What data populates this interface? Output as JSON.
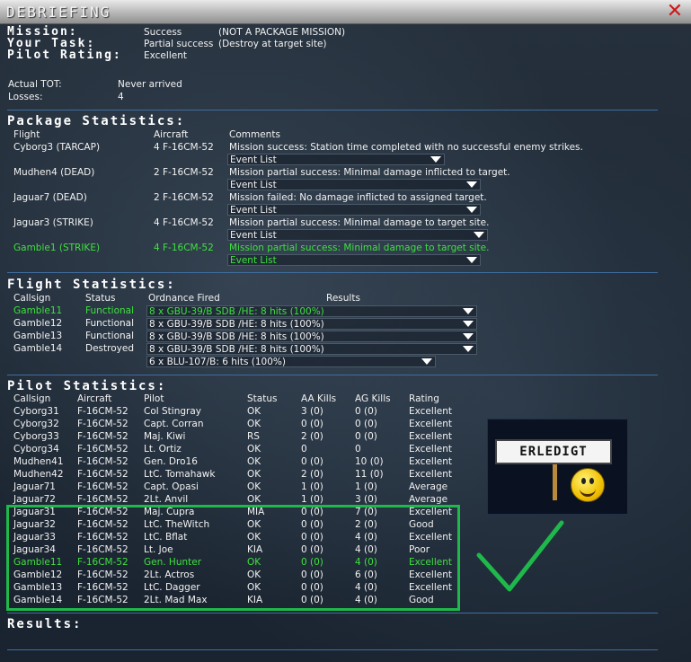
{
  "window": {
    "title": "DEBRIEFING"
  },
  "mission": {
    "labels": [
      "Mission:",
      "Your Task:",
      "Pilot Rating:"
    ],
    "values": [
      "Success",
      "Partial success",
      "Excellent"
    ],
    "notes": [
      "(NOT A PACKAGE MISSION)",
      "(Destroy  at target site)",
      ""
    ],
    "tot_label": "Actual TOT:",
    "tot_value": "Never arrived",
    "losses_label": "Losses:",
    "losses_value": "4"
  },
  "package": {
    "title": "Package Statistics:",
    "headers": [
      "Flight",
      "Aircraft",
      "Comments"
    ],
    "event_list_label": "Event List",
    "rows": [
      {
        "flight": "Cyborg3 (TARCAP)",
        "aircraft": "4 F-16CM-52",
        "comment": "Mission success: Station time completed with no successful enemy strikes.",
        "highlight": false
      },
      {
        "flight": "Mudhen4 (DEAD)",
        "aircraft": "2 F-16CM-52",
        "comment": "Mission partial success: Minimal damage inflicted to target.",
        "highlight": false
      },
      {
        "flight": "Jaguar7 (DEAD)",
        "aircraft": "2 F-16CM-52",
        "comment": "Mission failed: No damage inflicted to assigned target.",
        "highlight": false
      },
      {
        "flight": "Jaguar3 (STRIKE)",
        "aircraft": "4 F-16CM-52",
        "comment": "Mission partial success: Minimal damage to target site.",
        "highlight": false
      },
      {
        "flight": "Gamble1 (STRIKE)",
        "aircraft": "4 F-16CM-52",
        "comment": "Mission partial success: Minimal damage to target site.",
        "highlight": true
      }
    ]
  },
  "flight": {
    "title": "Flight Statistics:",
    "headers": [
      "Callsign",
      "Status",
      "Ordnance Fired",
      "Results"
    ],
    "rows": [
      {
        "callsign": "Gamble11",
        "status": "Functional",
        "ordnance": "8 x GBU-39/B SDB /HE: 8 hits (100%)",
        "highlight": true
      },
      {
        "callsign": "Gamble12",
        "status": "Functional",
        "ordnance": "8 x GBU-39/B SDB /HE: 8 hits (100%)",
        "highlight": false
      },
      {
        "callsign": "Gamble13",
        "status": "Functional",
        "ordnance": "8 x GBU-39/B SDB /HE: 8 hits (100%)",
        "highlight": false
      },
      {
        "callsign": "Gamble14",
        "status": "Destroyed",
        "ordnance": "8 x GBU-39/B SDB /HE: 8 hits (100%)",
        "highlight": false
      }
    ],
    "extra_ordnance": "6 x BLU-107/B: 6 hits (100%)"
  },
  "pilot": {
    "title": "Pilot Statistics:",
    "headers": [
      "Callsign",
      "Aircraft",
      "Pilot",
      "Status",
      "AA Kills",
      "AG Kills",
      "Rating"
    ],
    "rows": [
      {
        "callsign": "Cyborg31",
        "aircraft": "F-16CM-52",
        "pilot": "Col Stingray",
        "status": "OK",
        "aa": "3 (0)",
        "ag": "0 (0)",
        "rating": "Excellent",
        "highlight": false
      },
      {
        "callsign": "Cyborg32",
        "aircraft": "F-16CM-52",
        "pilot": "Capt. Corran",
        "status": "OK",
        "aa": "0 (0)",
        "ag": "0 (0)",
        "rating": "Excellent",
        "highlight": false
      },
      {
        "callsign": "Cyborg33",
        "aircraft": "F-16CM-52",
        "pilot": "Maj. Kiwi",
        "status": "RS",
        "aa": "2 (0)",
        "ag": "0 (0)",
        "rating": "Excellent",
        "highlight": false
      },
      {
        "callsign": "Cyborg34",
        "aircraft": "F-16CM-52",
        "pilot": "Lt. Ortiz",
        "status": "OK",
        "aa": "0",
        "ag": "0",
        "rating": "Excellent",
        "highlight": false
      },
      {
        "callsign": "Mudhen41",
        "aircraft": "F-16CM-52",
        "pilot": "Gen. Dro16",
        "status": "OK",
        "aa": "0 (0)",
        "ag": "10 (0)",
        "rating": "Excellent",
        "highlight": false
      },
      {
        "callsign": "Mudhen42",
        "aircraft": "F-16CM-52",
        "pilot": "LtC. Tomahawk",
        "status": "OK",
        "aa": "2 (0)",
        "ag": "11 (0)",
        "rating": "Excellent",
        "highlight": false
      },
      {
        "callsign": "Jaguar71",
        "aircraft": "F-16CM-52",
        "pilot": "Capt. Opasi",
        "status": "OK",
        "aa": "1 (0)",
        "ag": "1 (0)",
        "rating": "Average",
        "highlight": false
      },
      {
        "callsign": "Jaguar72",
        "aircraft": "F-16CM-52",
        "pilot": "2Lt. Anvil",
        "status": "OK",
        "aa": "1 (0)",
        "ag": "3 (0)",
        "rating": "Average",
        "highlight": false
      },
      {
        "callsign": "Jaguar31",
        "aircraft": "F-16CM-52",
        "pilot": "Maj. Cupra",
        "status": "MIA",
        "aa": "0 (0)",
        "ag": "7 (0)",
        "rating": "Excellent",
        "highlight": false
      },
      {
        "callsign": "Jaguar32",
        "aircraft": "F-16CM-52",
        "pilot": "LtC. TheWitch",
        "status": "OK",
        "aa": "0 (0)",
        "ag": "2 (0)",
        "rating": "Good",
        "highlight": false
      },
      {
        "callsign": "Jaguar33",
        "aircraft": "F-16CM-52",
        "pilot": "LtC. Bflat",
        "status": "OK",
        "aa": "0 (0)",
        "ag": "4 (0)",
        "rating": "Excellent",
        "highlight": false
      },
      {
        "callsign": "Jaguar34",
        "aircraft": "F-16CM-52",
        "pilot": "Lt. Joe",
        "status": "KIA",
        "aa": "0 (0)",
        "ag": "4 (0)",
        "rating": "Poor",
        "highlight": false
      },
      {
        "callsign": "Gamble11",
        "aircraft": "F-16CM-52",
        "pilot": "Gen. Hunter",
        "status": "OK",
        "aa": "0 (0)",
        "ag": "4 (0)",
        "rating": "Excellent",
        "highlight": true
      },
      {
        "callsign": "Gamble12",
        "aircraft": "F-16CM-52",
        "pilot": "2Lt. Actros",
        "status": "OK",
        "aa": "0 (0)",
        "ag": "6 (0)",
        "rating": "Excellent",
        "highlight": false
      },
      {
        "callsign": "Gamble13",
        "aircraft": "F-16CM-52",
        "pilot": "LtC. Dagger",
        "status": "OK",
        "aa": "0 (0)",
        "ag": "4 (0)",
        "rating": "Excellent",
        "highlight": false
      },
      {
        "callsign": "Gamble14",
        "aircraft": "F-16CM-52",
        "pilot": "2Lt. Mad Max",
        "status": "KIA",
        "aa": "0 (0)",
        "ag": "4 (0)",
        "rating": "Good",
        "highlight": false
      }
    ]
  },
  "results": {
    "title": "Results:"
  },
  "overlay": {
    "sign_text": "ERLEDIGT"
  },
  "colors": {
    "highlight_text": "#3fe03f",
    "annotation_green": "#1fb84a",
    "close_red": "#cc1a1a"
  }
}
